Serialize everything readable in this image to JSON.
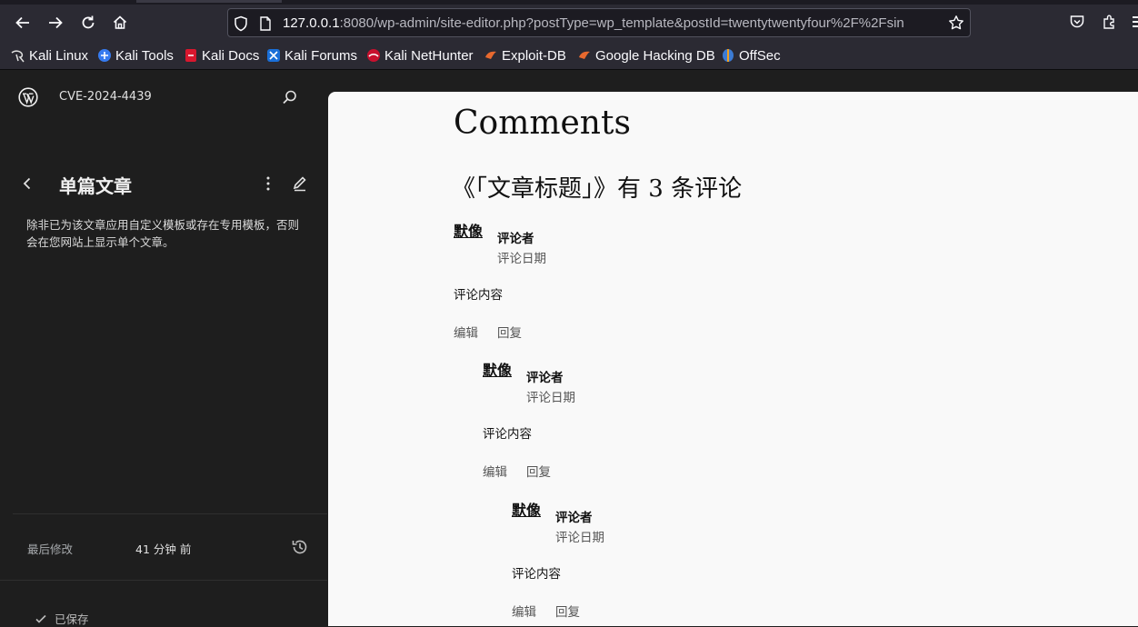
{
  "browser": {
    "url_host": "127.0.0.1",
    "url_rest": ":8080/wp-admin/site-editor.php?postType=wp_template&postId=twentytwentyfour%2F%2Fsin",
    "bookmarks": [
      {
        "label": "Kali Linux",
        "icon": "kali-dragon-icon"
      },
      {
        "label": "Kali Tools",
        "icon": "kali-tools-icon"
      },
      {
        "label": "Kali Docs",
        "icon": "kali-docs-icon"
      },
      {
        "label": "Kali Forums",
        "icon": "kali-forums-icon"
      },
      {
        "label": "Kali NetHunter",
        "icon": "kali-nethunter-icon"
      },
      {
        "label": "Exploit-DB",
        "icon": "exploit-db-icon"
      },
      {
        "label": "Google Hacking DB",
        "icon": "ghdb-icon"
      },
      {
        "label": "OffSec",
        "icon": "offsec-icon"
      }
    ]
  },
  "sidebar": {
    "site_name": "CVE-2024-4439",
    "template_title": "单篇文章",
    "template_description": "除非已为该文章应用自定义模板或存在专用模板，否则会在您网站上显示单个文章。",
    "last_modified_label": "最后修改",
    "last_modified_value": "41 分钟 前",
    "saved_label": "已保存"
  },
  "canvas": {
    "comments_title": "Comments",
    "comments_count": "《「文章标题」》有 3 条评论",
    "comments": [
      {
        "avatar": "默像",
        "author": "评论者",
        "date": "评论日期",
        "content": "评论内容",
        "edit": "编辑",
        "reply": "回复"
      },
      {
        "avatar": "默像",
        "author": "评论者",
        "date": "评论日期",
        "content": "评论内容",
        "edit": "编辑",
        "reply": "回复"
      },
      {
        "avatar": "默像",
        "author": "评论者",
        "date": "评论日期",
        "content": "评论内容",
        "edit": "编辑",
        "reply": "回复"
      }
    ]
  },
  "colors": {
    "chrome_bg": "#2b2a33",
    "admin_bg": "#1e1e1e",
    "canvas_bg": "#f9f9f9"
  }
}
